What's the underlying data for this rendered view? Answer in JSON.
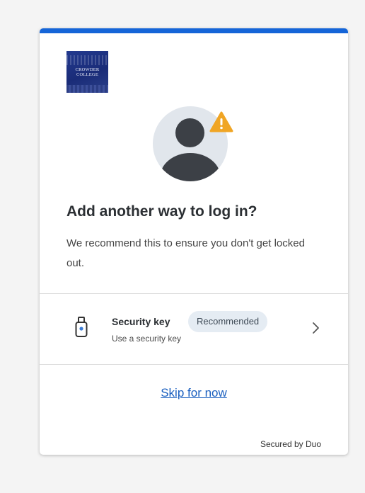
{
  "logo": {
    "line1": "CROWDER",
    "line2": "COLLEGE"
  },
  "icons": {
    "avatar": "user-avatar-icon",
    "warning": "warning-triangle-icon",
    "security_key": "security-key-icon",
    "chevron": "chevron-right-icon"
  },
  "heading": "Add another way to log in?",
  "description": "We recommend this to ensure you don't get locked out.",
  "option": {
    "name": "Security key",
    "badge": "Recommended",
    "subtitle": "Use a security key"
  },
  "skip_label": "Skip for now",
  "footer": "Secured by Duo",
  "colors": {
    "accent_bar": "#1565d8",
    "link": "#1a5fbf",
    "warning": "#f0a524",
    "badge_bg": "#e5ecf3",
    "key_dot": "#3a7bd5"
  }
}
